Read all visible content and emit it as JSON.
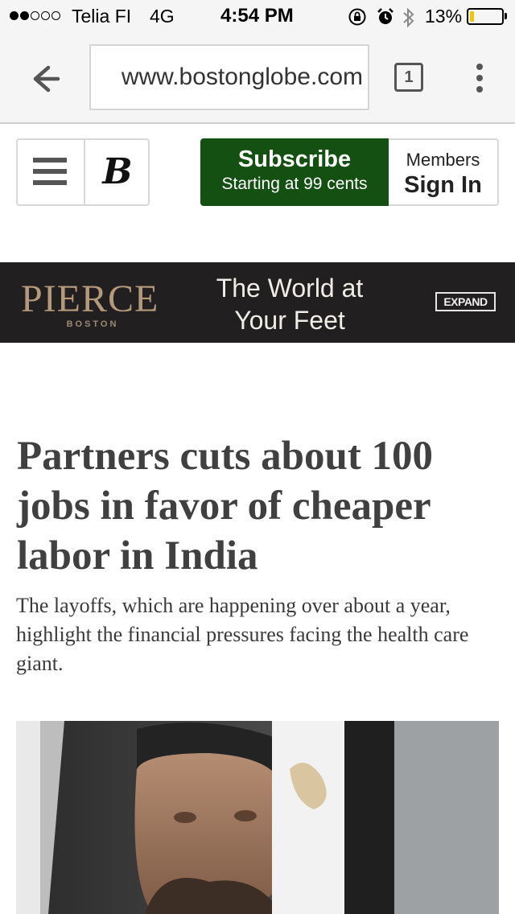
{
  "status_bar": {
    "carrier": "Telia FI",
    "network": "4G",
    "time": "4:54 PM",
    "battery_percent": "13%",
    "battery_level": 0.13,
    "signal_bars_filled": 2,
    "signal_bars_total": 5
  },
  "browser": {
    "url": "www.bostonglobe.com",
    "tab_count": "1"
  },
  "site_header": {
    "logo": "B",
    "subscribe_title": "Subscribe",
    "subscribe_subtitle": "Starting at 99 cents",
    "members_label": "Members",
    "sign_in_label": "Sign In",
    "subscribe_color": "#155013"
  },
  "ad": {
    "brand": "PIERCE",
    "brand_sub": "BOSTON",
    "tagline": "The World at Your Feet",
    "expand_label": "EXPAND"
  },
  "article": {
    "headline": "Partners cuts about 100 jobs in favor of cheaper labor in India",
    "dek": "The layoffs, which are happening over about a year, highlight the financial pressures facing the health care giant."
  },
  "icons": {
    "back": "arrow-left-icon",
    "menu": "vertical-dots-icon",
    "hamburger": "hamburger-icon",
    "orientation_lock": "orientation-lock-icon",
    "alarm": "alarm-icon",
    "bluetooth": "bluetooth-icon"
  }
}
